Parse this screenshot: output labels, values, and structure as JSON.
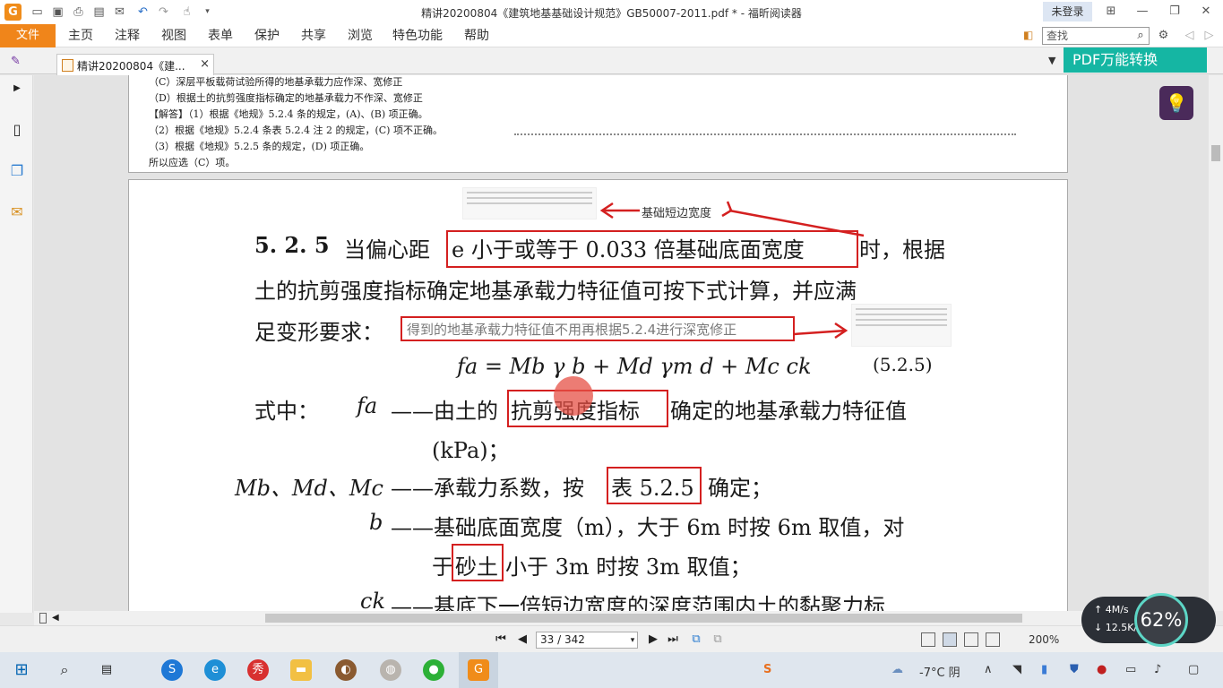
{
  "titlebar": {
    "app_logo": "G",
    "title": "精讲20200804《建筑地基基础设计规范》GB50007-2011.pdf * - 福昕阅读器",
    "login": "未登录",
    "icons": [
      "folder-icon",
      "save-icon",
      "print-icon",
      "fax-icon",
      "mail-icon",
      "undo-icon",
      "redo-icon",
      "hand-tool-icon",
      "dropdown-icon"
    ]
  },
  "menu": {
    "file": "文件",
    "items": [
      "主页",
      "注释",
      "视图",
      "表单",
      "保护",
      "共享",
      "浏览",
      "特色功能",
      "帮助"
    ],
    "search_placeholder": "查找"
  },
  "tab": {
    "label": "精讲20200804《建...",
    "close": "×",
    "pdf_convert": "PDF万能转换"
  },
  "page1": {
    "lines": [
      "（C）深层平板载荷试验所得的地基承载力应作深、宽修正",
      "（D）根据土的抗剪强度指标确定的地基承载力不作深、宽修正",
      "【解答】（1）根据《地规》5.2.4 条的规定，(A)、(B) 项正确。",
      "（2）根据《地规》5.2.4 条表 5.2.4 注 2 的规定，(C) 项不正确。",
      "（3）根据《地规》5.2.5 条的规定，(D) 项正确。",
      "所以应选（C）项。"
    ]
  },
  "page2": {
    "annotation_top": "基础短边宽度",
    "clause_no": "5. 2. 5",
    "line1_a": "当偏心距",
    "line1_box": "e 小于或等于 0.033 倍基础底面宽度",
    "line1_b": "时，根据",
    "line2": "土的抗剪强度指标确定地基承载力特征值可按下式计算，并应满",
    "line3": "足变形要求：",
    "annotation_mid": "得到的地基承载力特征值不用再根据5.2.4进行深宽修正",
    "formula": "fa = Mb γ b + Md γm d + Mc ck",
    "formula_no": "(5.2.5)",
    "where": "式中：",
    "fa_sym": "fa",
    "fa_a": "——由土的",
    "fa_box": "抗剪强度指标",
    "fa_b": "确定的地基承载力特征值",
    "kpa": "(kPa)；",
    "m_sym": "Mb、Md、Mc",
    "m_a": "——承载力系数，按",
    "m_box": "表 5.2.5",
    "m_b": "确定；",
    "b_sym": "b",
    "b_text": "——基础底面宽度（m），大于 6m 时按 6m 取值，对",
    "b2_a": "于",
    "b2_box": "砂土",
    "b2_b": "小于 3m 时按 3m 取值；",
    "ck_sym": "ck",
    "ck_text": "——基底下一倍短边宽度的深度范围内土的黏聚力标"
  },
  "status": {
    "page_value": "33 / 342",
    "zoom": "200%"
  },
  "speed": {
    "up": "4M/s",
    "down": "12.5K/s",
    "percent": "62%"
  },
  "taskbar": {
    "weather": "-7°C 阴",
    "apps": [
      "start",
      "search",
      "taskview",
      "sogou",
      "ie",
      "xiu",
      "explorer",
      "baidu",
      "tool",
      "wechat",
      "foxit"
    ]
  }
}
